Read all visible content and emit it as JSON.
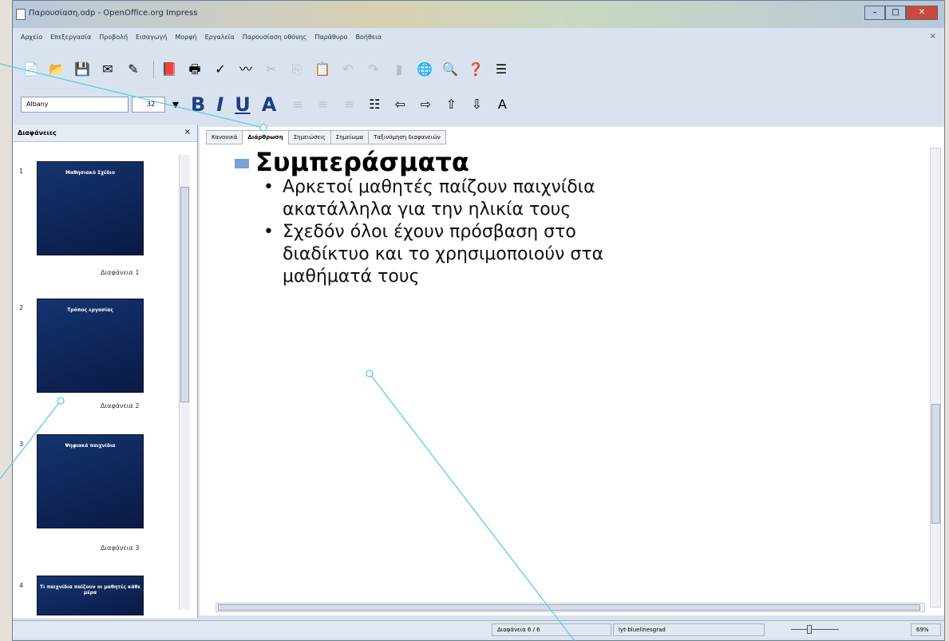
{
  "window": {
    "title": "Παρουσίαση.odp - OpenOffice.org Impress"
  },
  "menu": [
    "Αρχείο",
    "Επεξεργασία",
    "Προβολή",
    "Εισαγωγή",
    "Μορφή",
    "Εργαλεία",
    "Παρουσίαση οθόνης",
    "Παράθυρο",
    "Βοήθεια"
  ],
  "format": {
    "font": "Albany",
    "size": "32"
  },
  "slides_panel": {
    "title": "Διαφάνειες",
    "items": [
      {
        "num": "1",
        "title": "Μαθησιακό Σχέδιο",
        "label": "Διαφάνεια 1"
      },
      {
        "num": "2",
        "title": "Τρόπος εργασίας",
        "label": "Διαφάνεια 2"
      },
      {
        "num": "3",
        "title": "Ψηφιακά παιχνίδια",
        "label": "Διαφάνεια 3"
      },
      {
        "num": "4",
        "title": "Τι παιχνίδια παίζουν οι μαθητές κάθε μέρα",
        "label": ""
      }
    ]
  },
  "tabs": [
    "Κανονικά",
    "Διάρθρωση",
    "Σημειώσεις",
    "Σημείωμα",
    "Ταξινόμηση διαφανειών"
  ],
  "outline": {
    "heading": "Συμπεράσματα",
    "bullets": [
      "Αρκετοί μαθητές παίζουν παιχνίδια ακατάλληλα για την ηλικία τους",
      "Σχεδόν όλοι έχουν πρόσβαση στο διαδίκτυο και το χρησιμοποιούν στα μαθήματά τους"
    ]
  },
  "status": {
    "slide": "Διαφάνεια 6 / 6",
    "layout": "lyt-bluelinesgrad",
    "zoom": "69%"
  },
  "colors": {
    "slide_bg": "#153470",
    "callout_line": "#5ec9e8"
  },
  "icons": [
    "new-icon",
    "open-icon",
    "save-icon",
    "mail-icon",
    "edit-icon",
    "pdf-icon",
    "print-icon",
    "spellcheck-icon",
    "autospell-icon",
    "navigator-icon",
    "help-icon",
    "bold-icon",
    "italic-icon",
    "underline-icon",
    "bullets-icon",
    "arrow-left-icon",
    "arrow-right-icon",
    "arrow-up-icon",
    "arrow-down-icon",
    "font-color-icon"
  ]
}
